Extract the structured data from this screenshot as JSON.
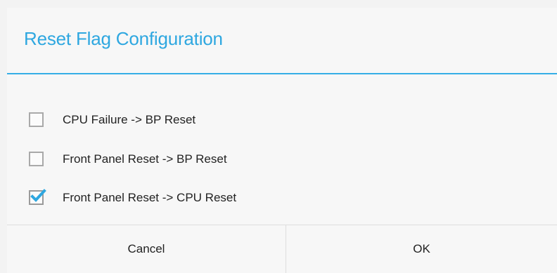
{
  "dialog": {
    "title": "Reset Flag Configuration",
    "accent_color": "#2ea7e0",
    "options": [
      {
        "label": "CPU Failure -> BP Reset",
        "checked": false
      },
      {
        "label": "Front Panel Reset -> BP Reset",
        "checked": false
      },
      {
        "label": "Front Panel Reset -> CPU Reset",
        "checked": true
      }
    ],
    "buttons": {
      "cancel_label": "Cancel",
      "ok_label": "OK"
    }
  },
  "icons": {
    "checkmark": "checkmark-icon"
  }
}
